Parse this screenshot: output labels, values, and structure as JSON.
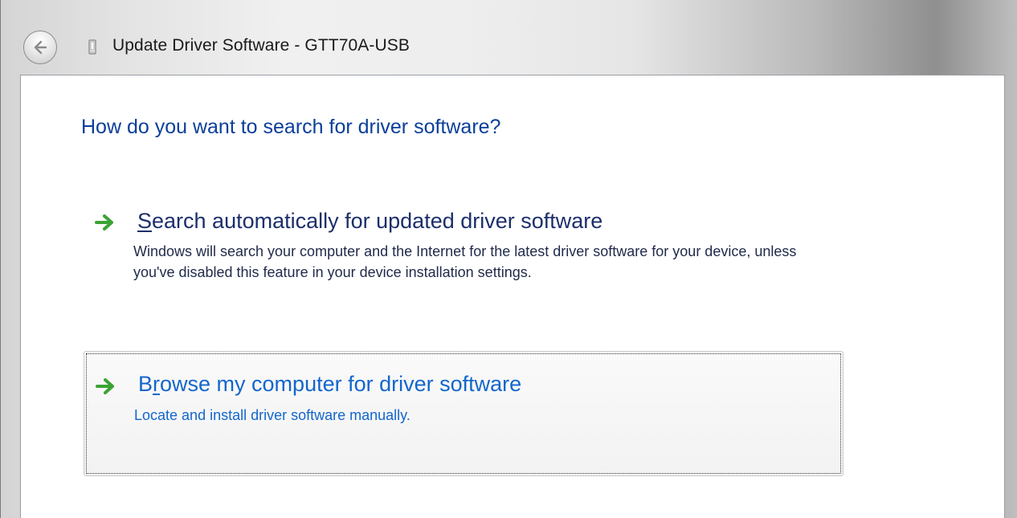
{
  "window": {
    "title": "Update Driver Software - GTT70A-USB"
  },
  "icons": {
    "back": "back-arrow-icon",
    "device": "usb-device-icon",
    "option_arrow": "green-arrow-icon"
  },
  "colors": {
    "heading": "#0a3f9a",
    "link": "#1366cc",
    "arrow": "#3aa335"
  },
  "main": {
    "heading": "How do you want to search for driver software?",
    "options": [
      {
        "title_first": "S",
        "title_rest": "earch automatically for updated driver software",
        "description": "Windows will search your computer and the Internet for the latest driver software for your device, unless you've disabled this feature in your device installation settings."
      },
      {
        "title_first": "B",
        "title_accel": "r",
        "title_rest": "owse my computer for driver software",
        "description": "Locate and install driver software manually."
      }
    ]
  }
}
